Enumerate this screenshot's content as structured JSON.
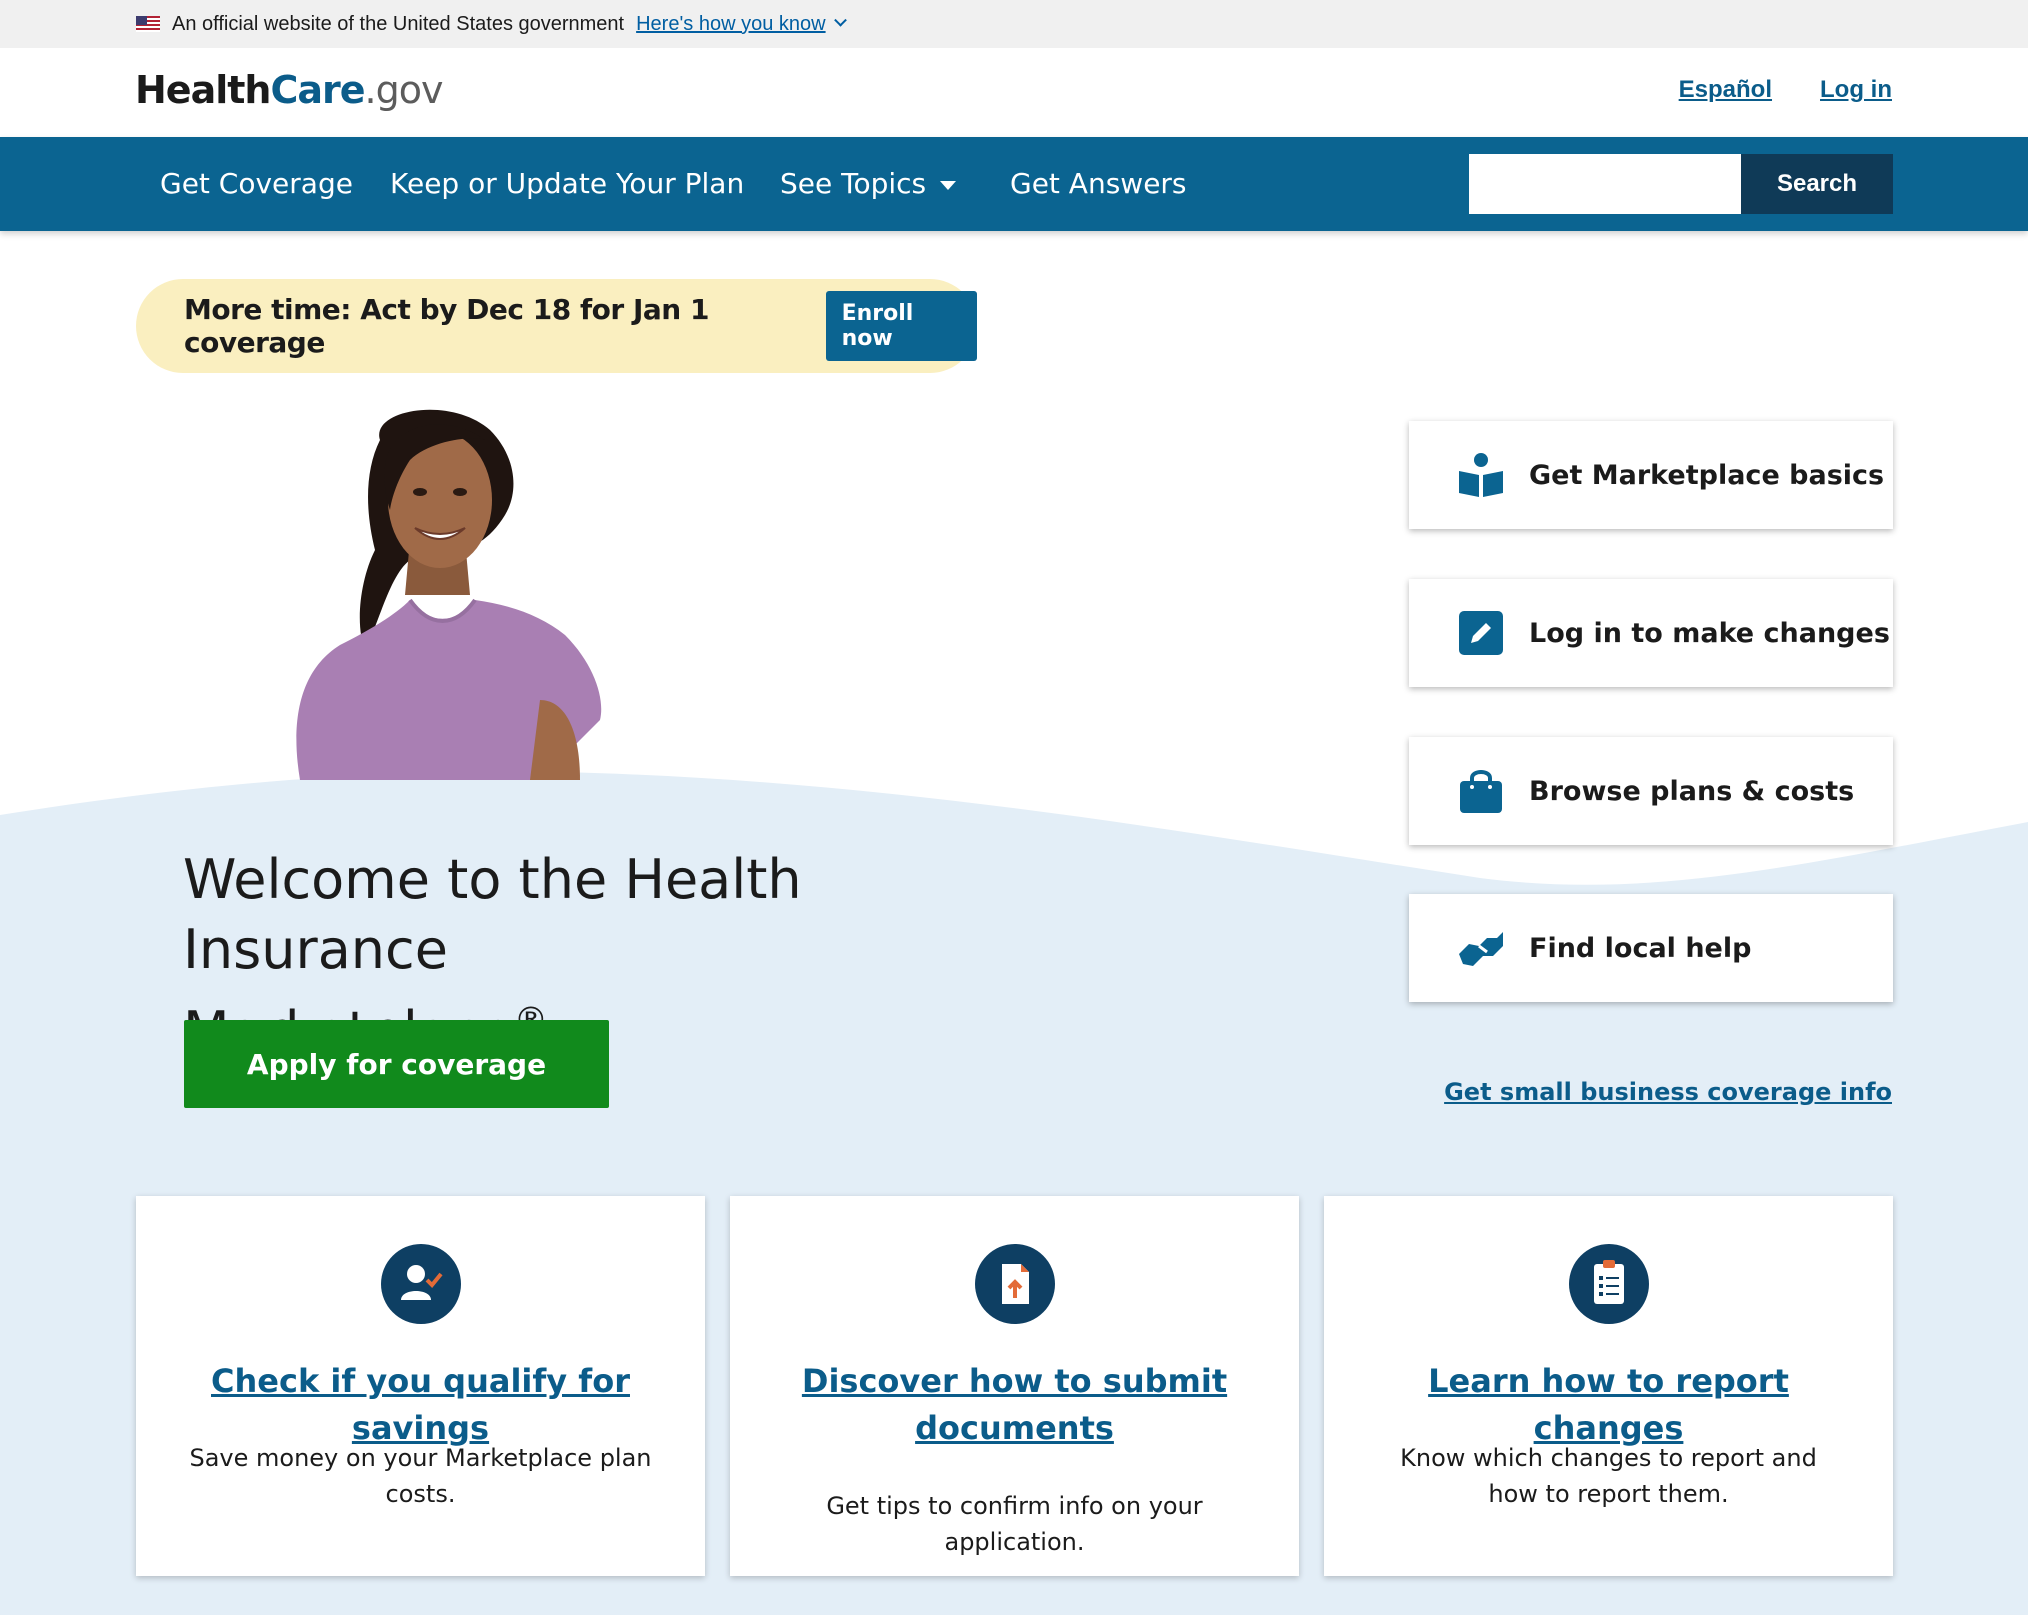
{
  "gov_banner": {
    "text": "An official website of the United States government",
    "link": "Here's how you know"
  },
  "header": {
    "logo": {
      "part1": "Health",
      "part2": "Care",
      "part3": ".gov"
    },
    "links": {
      "espanol": "Español",
      "login": "Log in"
    }
  },
  "nav": {
    "items": [
      "Get Coverage",
      "Keep or Update Your Plan",
      "See Topics",
      "Get Answers"
    ],
    "search_placeholder": "",
    "search_button": "Search"
  },
  "alert": {
    "text": "More time: Act by Dec 18 for Jan 1 coverage",
    "button": "Enroll now"
  },
  "hero": {
    "title_line1": "Welcome to the Health Insurance",
    "title_line2": "Marketplace",
    "reg": "®",
    "apply_button": "Apply for coverage"
  },
  "side_cards": [
    {
      "label": "Get Marketplace basics",
      "icon": "reader-book-icon"
    },
    {
      "label": "Log in to make changes",
      "icon": "pencil-icon"
    },
    {
      "label": "Browse plans & costs",
      "icon": "shopping-bag-icon"
    },
    {
      "label": "Find local help",
      "icon": "handshake-icon"
    }
  ],
  "small_business_link": "Get small business coverage info",
  "cards": [
    {
      "title": "Check if you qualify for savings",
      "desc": "Save money on your Marketplace plan costs.",
      "icon": "person-check-icon"
    },
    {
      "title": "Discover how to submit documents",
      "desc": "Get tips to confirm info on your application.",
      "icon": "document-upload-icon"
    },
    {
      "title": "Learn how to report changes",
      "desc": "Know which changes to report and how to report them.",
      "icon": "clipboard-list-icon"
    }
  ],
  "colors": {
    "nav_blue": "#0b6491",
    "link_blue": "#0b5c8a",
    "apply_green": "#118a1c",
    "alert_yellow": "#faefc0",
    "hero_light_blue": "#e3eef7"
  }
}
